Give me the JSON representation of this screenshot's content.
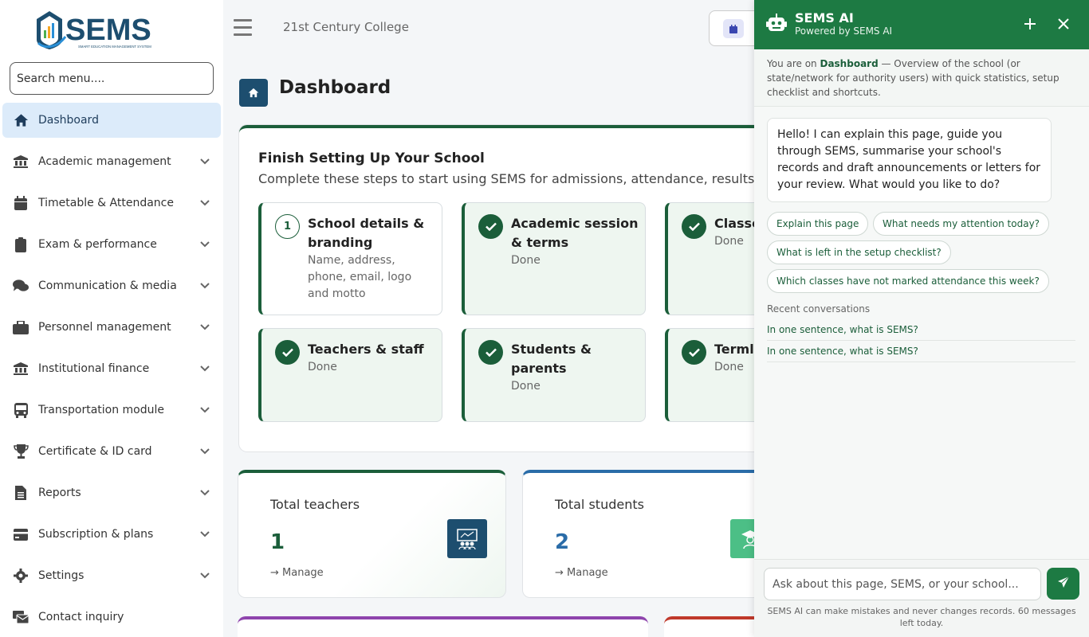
{
  "app": {
    "logo_text": "SEMS",
    "logo_tagline": "SMART EDUCATION MANAGEMENT SYSTEM",
    "college_name": "21st Century College"
  },
  "sidebar": {
    "search_placeholder": "Search menu....",
    "items": [
      {
        "label": "Dashboard",
        "icon": "home-icon",
        "active": true
      },
      {
        "label": "Academic management",
        "icon": "institution-icon"
      },
      {
        "label": "Timetable & Attendance",
        "icon": "calendar-icon"
      },
      {
        "label": "Exam & performance",
        "icon": "clipboard-icon"
      },
      {
        "label": "Communication & media",
        "icon": "chat-icon"
      },
      {
        "label": "Personnel management",
        "icon": "briefcase-icon"
      },
      {
        "label": "Institutional finance",
        "icon": "bank-icon"
      },
      {
        "label": "Transportation module",
        "icon": "bus-icon"
      },
      {
        "label": "Certificate & ID card",
        "icon": "trophy-icon"
      },
      {
        "label": "Reports",
        "icon": "document-icon"
      },
      {
        "label": "Subscription & plans",
        "icon": "card-icon"
      },
      {
        "label": "Settings",
        "icon": "gear-icon"
      },
      {
        "label": "Contact inquiry",
        "icon": "contact-icon"
      }
    ]
  },
  "main": {
    "page_title": "Dashboard",
    "setup": {
      "title": "Finish Setting Up Your School",
      "subtitle": "Complete these steps to start using SEMS for admissions, attendance, results and",
      "steps": [
        {
          "number": "1",
          "title": "School details & branding",
          "desc": "Name, address, phone, email, logo and motto",
          "done": false
        },
        {
          "title": "Academic session & terms",
          "desc": "Done",
          "done": true
        },
        {
          "title": "Classe",
          "desc": "Done",
          "done": true
        },
        {
          "title": "Teachers & staff",
          "desc": "Done",
          "done": true
        },
        {
          "title": "Students & parents",
          "desc": "Done",
          "done": true
        },
        {
          "title": "Terml",
          "desc": "Done",
          "done": true
        }
      ]
    },
    "stats": [
      {
        "label": "Total teachers",
        "value": "1",
        "link": "Manage",
        "color": "#1b5e3a"
      },
      {
        "label": "Total students",
        "value": "2",
        "link": "Manage",
        "color": "#2a6ca8"
      }
    ]
  },
  "ai": {
    "title": "SEMS AI",
    "subtitle": "Powered by SEMS AI",
    "context_prefix": "You are on ",
    "context_page": "Dashboard",
    "context_rest": " — Overview of the school (or state/network for authority users) with quick statistics, setup checklist and shortcuts.",
    "greeting": "Hello! I can explain this page, guide you through SEMS, summarise your school's records and draft announcements or letters for your review. What would you like to do?",
    "suggestions": [
      "Explain this page",
      "What needs my attention today?",
      "What is left in the setup checklist?",
      "Which classes have not marked attendance this week?"
    ],
    "recent_heading": "Recent conversations",
    "recent": [
      "In one sentence, what is SEMS?",
      "In one sentence, what is SEMS?"
    ],
    "input_placeholder": "Ask about this page, SEMS, or your school...",
    "footer_note": "SEMS AI can make mistakes and never changes records. 60 messages left today."
  }
}
